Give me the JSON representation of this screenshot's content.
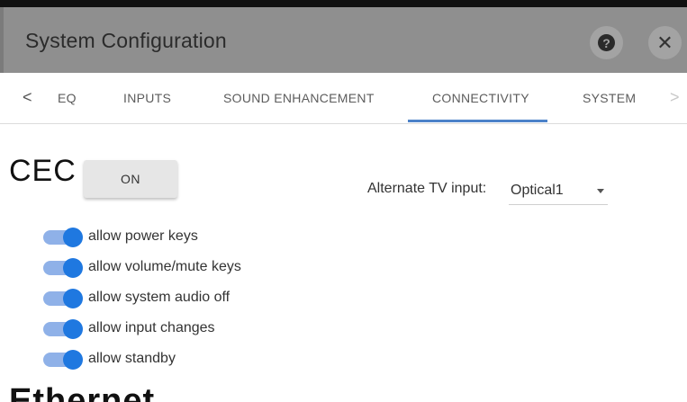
{
  "window": {
    "title": "System Configuration",
    "help_icon": "question-circle-icon",
    "close_icon": "close-icon",
    "close_glyph": "✕",
    "help_glyph": "?"
  },
  "tabs": {
    "prev_glyph": "<",
    "next_glyph": ">",
    "items": [
      {
        "label": "EQ"
      },
      {
        "label": "INPUTS"
      },
      {
        "label": "SOUND ENHANCEMENT"
      },
      {
        "label": "CONNECTIVITY"
      },
      {
        "label": "SYSTEM"
      }
    ],
    "active": "CONNECTIVITY",
    "active_color": "#4c82c9"
  },
  "cec": {
    "heading": "CEC",
    "button_label": "ON",
    "alt_tv_label": "Alternate TV input:",
    "alt_tv_value": "Optical1",
    "toggles": [
      {
        "label": "allow power keys",
        "on": true
      },
      {
        "label": "allow volume/mute keys",
        "on": true
      },
      {
        "label": "allow system audio off",
        "on": true
      },
      {
        "label": "allow input changes",
        "on": true
      },
      {
        "label": "allow standby",
        "on": true
      }
    ],
    "toggle_color": "#1f78e0"
  },
  "ethernet": {
    "heading": "Ethernet"
  }
}
